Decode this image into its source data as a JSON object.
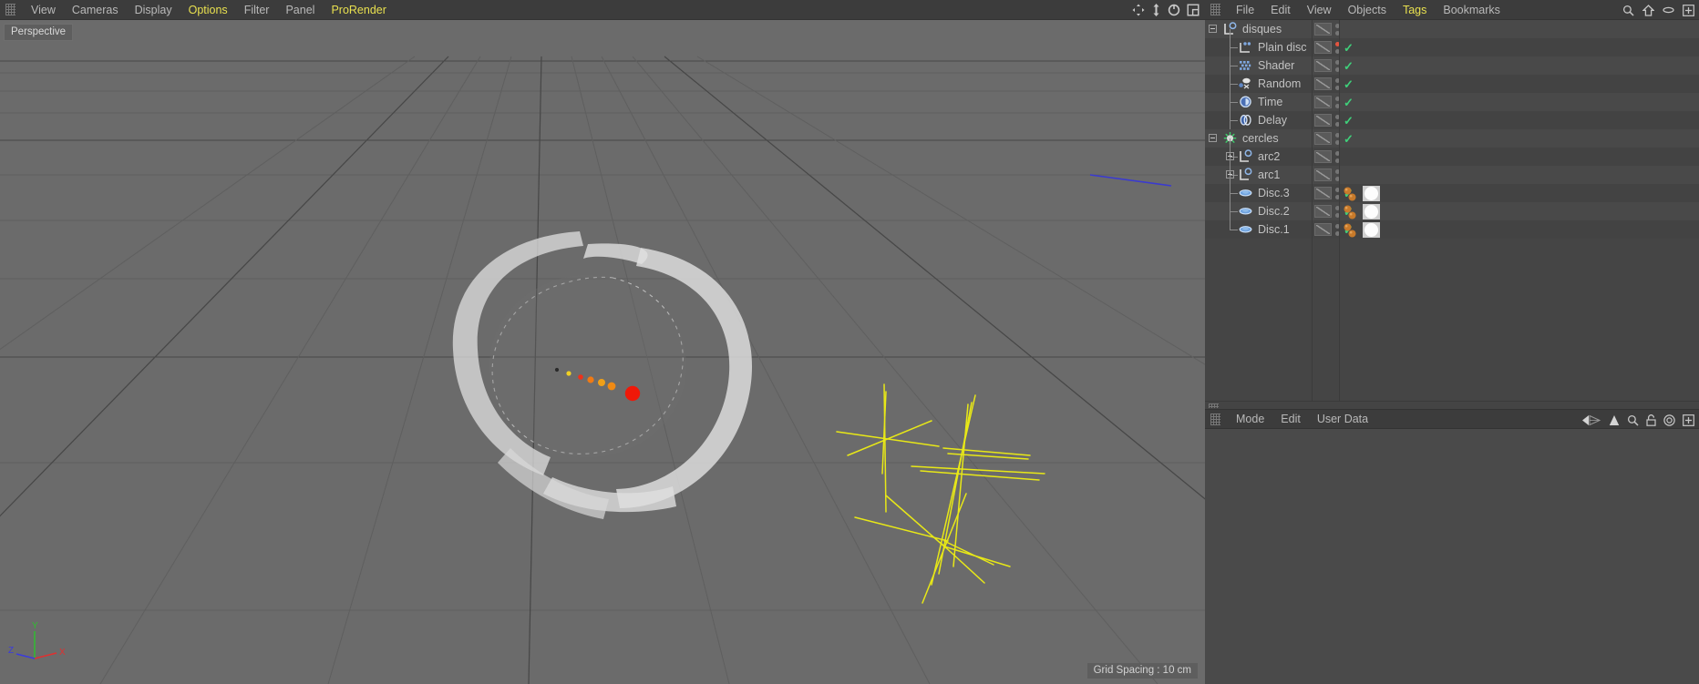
{
  "viewport": {
    "menu": [
      {
        "label": "View",
        "highlight": false
      },
      {
        "label": "Cameras",
        "highlight": false
      },
      {
        "label": "Display",
        "highlight": false
      },
      {
        "label": "Options",
        "highlight": true
      },
      {
        "label": "Filter",
        "highlight": false
      },
      {
        "label": "Panel",
        "highlight": false
      },
      {
        "label": "ProRender",
        "highlight": true
      }
    ],
    "nav_icons": [
      "move-icon",
      "zoom-icon",
      "rotate-icon",
      "viewport-layout-icon"
    ],
    "label": "Perspective",
    "status": "Grid Spacing : 10 cm",
    "axis": {
      "x": "X",
      "y": "Y",
      "z": "Z",
      "x_color": "#e03030",
      "y_color": "#2fbd2f",
      "z_color": "#3b3bdd"
    },
    "colors": {
      "background": "#6b6b6b",
      "grid_line": "#5d5d5d",
      "grid_axis": "#3d3d3d",
      "disc_white": "#e6e6e6",
      "spline_yellow": "#e8e817",
      "z_axis_blue": "#3a3ad0"
    }
  },
  "object_manager": {
    "menu": [
      {
        "label": "File",
        "highlight": false
      },
      {
        "label": "Edit",
        "highlight": false
      },
      {
        "label": "View",
        "highlight": false
      },
      {
        "label": "Objects",
        "highlight": false
      },
      {
        "label": "Tags",
        "highlight": true
      },
      {
        "label": "Bookmarks",
        "highlight": false
      }
    ],
    "right_icons": [
      "search-icon",
      "home-icon",
      "minimize-icon",
      "maximize-icon"
    ],
    "tree": [
      {
        "label": "disques",
        "icon": "null-object-icon",
        "depth": 0,
        "expander": "minus",
        "dot_top": "gray",
        "dot_bottom": "gray",
        "check": false,
        "materials": 0,
        "thumb": false
      },
      {
        "label": "Plain disc",
        "icon": "mograph-cloner-icon",
        "depth": 1,
        "expander": "none",
        "dot_top": "red",
        "dot_bottom": "gray",
        "check": true,
        "materials": 0,
        "thumb": false
      },
      {
        "label": "Shader",
        "icon": "shader-effector-icon",
        "depth": 1,
        "expander": "none",
        "dot_top": "gray",
        "dot_bottom": "gray",
        "check": true,
        "materials": 0,
        "thumb": false
      },
      {
        "label": "Random",
        "icon": "random-effector-icon",
        "depth": 1,
        "expander": "none",
        "dot_top": "gray",
        "dot_bottom": "gray",
        "check": true,
        "materials": 0,
        "thumb": false
      },
      {
        "label": "Time",
        "icon": "time-effector-icon",
        "depth": 1,
        "expander": "none",
        "dot_top": "gray",
        "dot_bottom": "gray",
        "check": true,
        "materials": 0,
        "thumb": false
      },
      {
        "label": "Delay",
        "icon": "delay-effector-icon",
        "depth": 1,
        "expander": "none",
        "dot_top": "gray",
        "dot_bottom": "gray",
        "check": true,
        "materials": 0,
        "thumb": false
      },
      {
        "label": "cercles",
        "icon": "mograph-matrix-icon",
        "depth": 0,
        "expander": "minus",
        "dot_top": "gray",
        "dot_bottom": "gray",
        "check": true,
        "materials": 0,
        "thumb": false
      },
      {
        "label": "arc2",
        "icon": "null-object-icon",
        "depth": 1,
        "expander": "plus",
        "dot_top": "gray",
        "dot_bottom": "gray",
        "check": false,
        "materials": 0,
        "thumb": false
      },
      {
        "label": "arc1",
        "icon": "null-object-icon",
        "depth": 1,
        "expander": "plus",
        "dot_top": "gray",
        "dot_bottom": "gray",
        "check": false,
        "materials": 0,
        "thumb": false
      },
      {
        "label": "Disc.3",
        "icon": "disc-object-icon",
        "depth": 1,
        "expander": "none",
        "dot_top": "gray",
        "dot_bottom": "gray",
        "check": true,
        "materials": 2,
        "thumb": true
      },
      {
        "label": "Disc.2",
        "icon": "disc-object-icon",
        "depth": 1,
        "expander": "none",
        "dot_top": "gray",
        "dot_bottom": "gray",
        "check": true,
        "materials": 2,
        "thumb": true
      },
      {
        "label": "Disc.1",
        "icon": "disc-object-icon",
        "depth": 1,
        "expander": "none",
        "dot_top": "gray",
        "dot_bottom": "gray",
        "check": true,
        "materials": 2,
        "thumb": true
      }
    ]
  },
  "attribute_manager": {
    "menu": [
      {
        "label": "Mode",
        "highlight": false
      },
      {
        "label": "Edit",
        "highlight": false
      },
      {
        "label": "User Data",
        "highlight": false
      }
    ],
    "right_icons": [
      "back-nav-icon",
      "up-nav-icon",
      "search-icon",
      "lock-icon",
      "target-icon",
      "maximize-icon"
    ]
  }
}
